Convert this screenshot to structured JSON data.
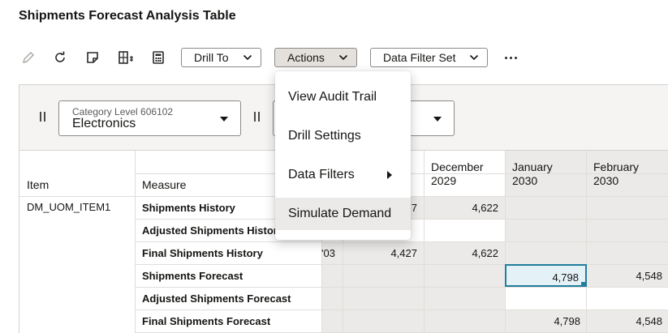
{
  "page": {
    "title": "Shipments Forecast Analysis Table"
  },
  "toolbar": {
    "icons": [
      "pencil-icon",
      "refresh-icon",
      "note-icon",
      "grid-settings-icon",
      "calculator-icon"
    ],
    "drill_to": "Drill To",
    "actions": "Actions",
    "data_filter_set": "Data Filter Set",
    "more_icon": "more-horizontal-icon"
  },
  "filters": [
    {
      "label": "Category Level 606102",
      "value": "Electronics"
    },
    {
      "label": "",
      "value": ""
    }
  ],
  "actions_menu": {
    "items": [
      {
        "label": "View Audit Trail",
        "submenu": false
      },
      {
        "label": "Drill Settings",
        "submenu": false
      },
      {
        "label": "Data Filters",
        "submenu": true
      },
      {
        "label": "Simulate Demand",
        "submenu": false,
        "highlighted": true
      }
    ]
  },
  "table": {
    "headers": {
      "item": "Item",
      "measure": "Measure",
      "col_dec_line1": "December",
      "col_dec_line2": "2029",
      "col_jan_line1": "January",
      "col_jan_line2": "2030",
      "col_feb_line1": "February",
      "col_feb_line2": "2030"
    },
    "item": "DM_UOM_ITEM1",
    "rows": [
      {
        "measure": "Shipments History",
        "partial_a": "",
        "partial_b": "7",
        "dec": "4,622",
        "jan": "",
        "feb": ""
      },
      {
        "measure": "Adjusted Shipments History",
        "partial_a": "",
        "partial_b": "",
        "dec": "",
        "jan": "",
        "feb": ""
      },
      {
        "measure": "Final Shipments History",
        "partial_a": "'03",
        "partial_b": "4,427",
        "dec": "4,622",
        "jan": "",
        "feb": ""
      },
      {
        "measure": "Shipments Forecast",
        "partial_a": "",
        "partial_b": "",
        "dec": "",
        "jan": "4,798",
        "feb": "4,548"
      },
      {
        "measure": "Adjusted Shipments Forecast",
        "partial_a": "",
        "partial_b": "",
        "dec": "",
        "jan": "",
        "feb": ""
      },
      {
        "measure": "Final Shipments Forecast",
        "partial_a": "",
        "partial_b": "",
        "dec": "",
        "jan": "4,798",
        "feb": "4,548"
      }
    ]
  },
  "colors": {
    "selected_cell_bg": "#e4f1f7",
    "selected_cell_border": "#227e9e",
    "readonly_bg": "#ebeae8"
  }
}
